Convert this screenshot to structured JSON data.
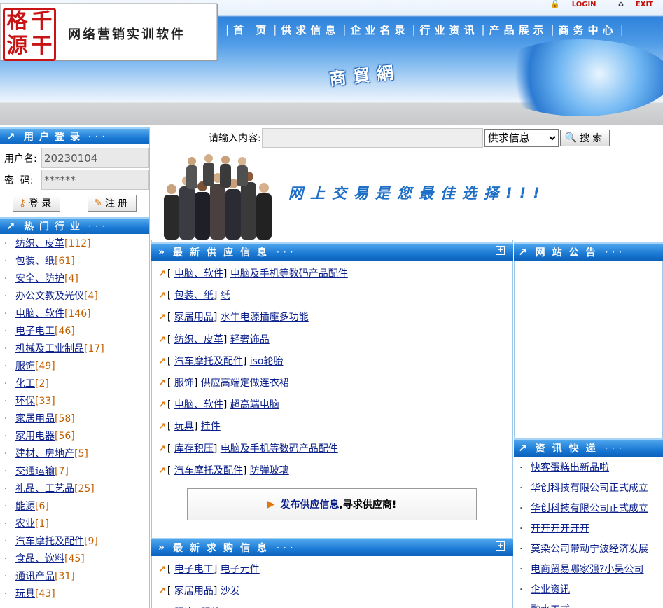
{
  "header": {
    "logo_seal_chars": [
      "格",
      "千",
      "源",
      "干"
    ],
    "logo_title": "网络营销实训软件",
    "login_label": "LOGIN",
    "exit_label": "EXIT",
    "nav": [
      "首 页",
      "供求信息",
      "企业名录",
      "行业资讯",
      "产品展示",
      "商务中心"
    ],
    "center_logo": "商貿網"
  },
  "login": {
    "title": "用户登录",
    "username_label": "用户名:",
    "username_value": "20230104",
    "password_label": "密  码:",
    "password_value": "******",
    "login_button": "登录",
    "register_button": "注册"
  },
  "hot_industries": {
    "title": "热门行业",
    "items": [
      {
        "name": "纺织、皮革",
        "count": "[112]"
      },
      {
        "name": "包装、纸",
        "count": "[61]"
      },
      {
        "name": "安全、防护",
        "count": "[4]"
      },
      {
        "name": "办公文教及光仪",
        "count": "[4]"
      },
      {
        "name": "电脑、软件",
        "count": "[146]"
      },
      {
        "name": "电子电工",
        "count": "[46]"
      },
      {
        "name": "机械及工业制品",
        "count": "[17]"
      },
      {
        "name": "服饰",
        "count": "[49]"
      },
      {
        "name": "化工",
        "count": "[2]"
      },
      {
        "name": "环保",
        "count": "[33]"
      },
      {
        "name": "家居用品",
        "count": "[58]"
      },
      {
        "name": "家用电器",
        "count": "[56]"
      },
      {
        "name": "建材、房地产",
        "count": "[5]"
      },
      {
        "name": "交通运输",
        "count": "[7]"
      },
      {
        "name": "礼品、工艺品",
        "count": "[25]"
      },
      {
        "name": "能源",
        "count": "[6]"
      },
      {
        "name": "农业",
        "count": "[1]"
      },
      {
        "name": "汽车摩托及配件",
        "count": "[9]"
      },
      {
        "name": "食品、饮料",
        "count": "[45]"
      },
      {
        "name": "通讯产品",
        "count": "[31]"
      },
      {
        "name": "玩具",
        "count": "[43]"
      }
    ]
  },
  "search": {
    "label": "请输入内容:",
    "input_value": "",
    "select_value": "供求信息",
    "button": "搜索"
  },
  "banner": {
    "slogan": "网上交易是您最佳选择!!!"
  },
  "supply": {
    "title": "最新供应信息",
    "items": [
      {
        "category": "电脑、软件",
        "title": "电脑及手机等数码产品配件"
      },
      {
        "category": "包装、纸",
        "title": "纸"
      },
      {
        "category": "家居用品",
        "title": "水牛电源插座多功能"
      },
      {
        "category": "纺织、皮革",
        "title": "轻奢饰品"
      },
      {
        "category": "汽车摩托及配件",
        "title": "iso轮胎"
      },
      {
        "category": "服饰",
        "title": "供应高端定做连衣裙"
      },
      {
        "category": "电脑、软件",
        "title": "超高端电脑"
      },
      {
        "category": "玩具",
        "title": "挂件"
      },
      {
        "category": "库存积压",
        "title": "电脑及手机等数码产品配件"
      },
      {
        "category": "汽车摩托及配件",
        "title": "防弹玻璃"
      }
    ],
    "publish_link": "发布供应信息",
    "publish_suffix": ",寻求供应商!"
  },
  "demand": {
    "title": "最新求购信息",
    "items": [
      {
        "category": "电子电工",
        "title": "电子元件"
      },
      {
        "category": "家居用品",
        "title": "沙发"
      },
      {
        "category": "服饰",
        "title": "服装"
      }
    ]
  },
  "notice": {
    "title": "网站公告"
  },
  "news": {
    "title": "资讯快递",
    "items": [
      "快客蛋糕出新品啦",
      "华创科技有限公司正式成立",
      "华创科技有限公司正式成立",
      "开开开开开开",
      "莫染公司带动宁波经济发展",
      "电商贸易哪家强?小吴公司",
      "企业资讯",
      "融水工式"
    ]
  }
}
